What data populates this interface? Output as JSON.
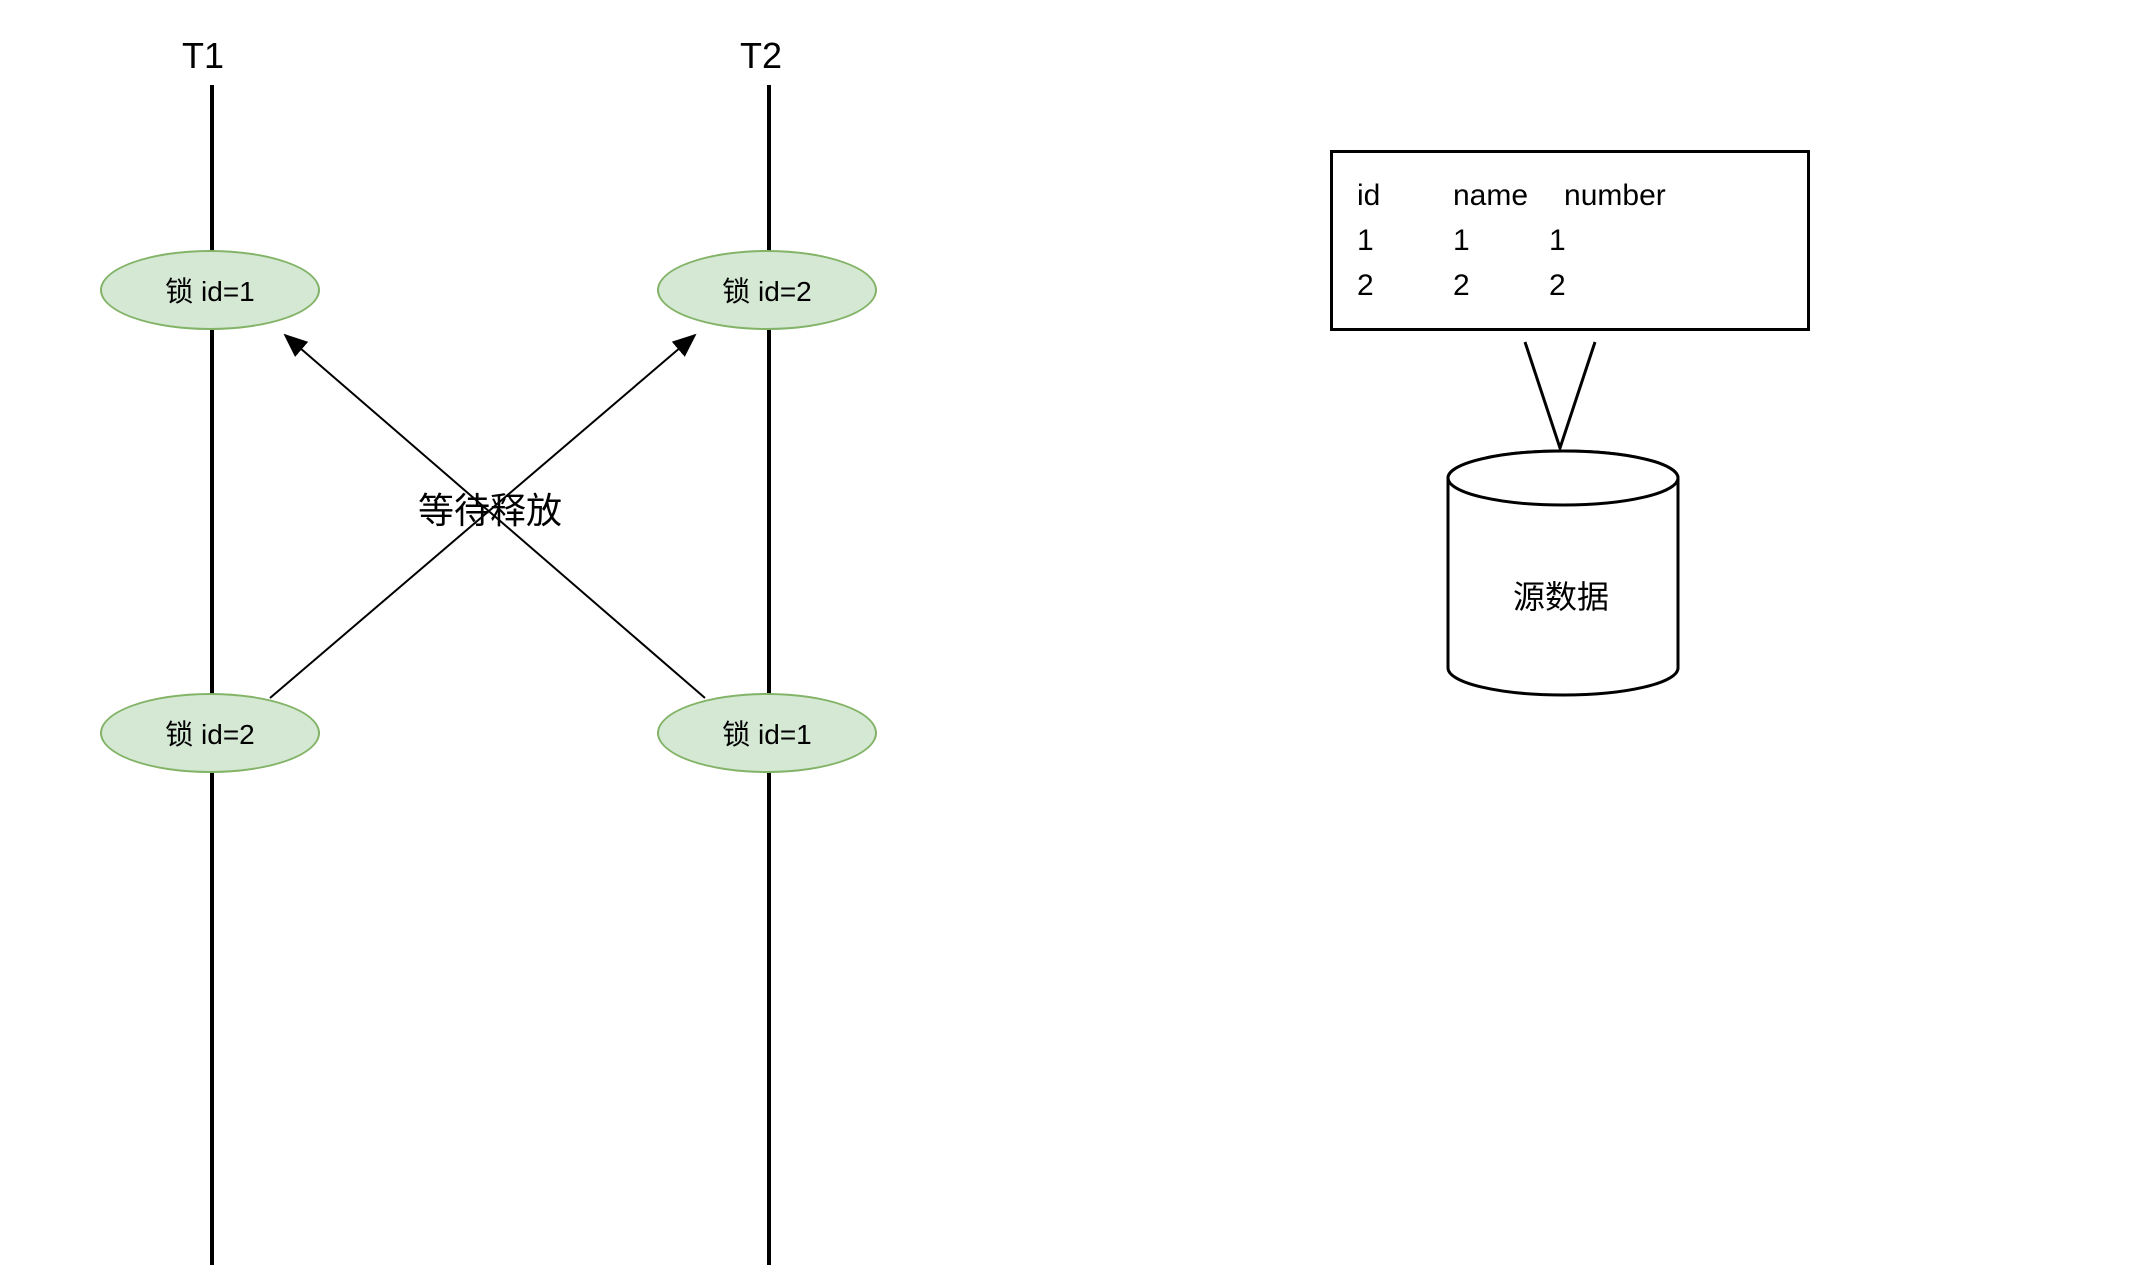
{
  "threads": {
    "t1": {
      "label": "T1"
    },
    "t2": {
      "label": "T2"
    }
  },
  "locks": {
    "t1_top": "锁 id=1",
    "t2_top": "锁 id=2",
    "t1_bottom": "锁 id=2",
    "t2_bottom": "锁 id=1"
  },
  "center_label": "等待释放",
  "table": {
    "headers": {
      "col1": "id",
      "col2": "name",
      "col3": "number"
    },
    "rows": [
      {
        "col1": "1",
        "col2": "1",
        "col3": "1"
      },
      {
        "col1": "2",
        "col2": "2",
        "col3": "2"
      }
    ]
  },
  "cylinder_label": "源数据"
}
